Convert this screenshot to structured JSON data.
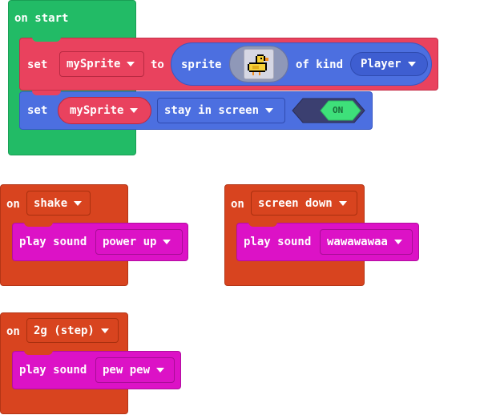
{
  "on_start": {
    "hat_label": "on start",
    "set1": {
      "keyword": "set",
      "variable": "mySprite",
      "to_label": "to",
      "sprite_label": "sprite",
      "of_kind_label": "of kind",
      "kind": "Player",
      "image": "duck-sprite"
    },
    "set2": {
      "keyword": "set",
      "variable": "mySprite",
      "property": "stay in screen",
      "toggle": "ON"
    }
  },
  "event_blocks": [
    {
      "on_label": "on",
      "event": "shake",
      "action_label": "play sound",
      "sound": "power up"
    },
    {
      "on_label": "on",
      "event": "screen down",
      "action_label": "play sound",
      "sound": "wawawawaa"
    },
    {
      "on_label": "on",
      "event": "2g (step)",
      "action_label": "play sound",
      "sound": "pew pew"
    }
  ],
  "colors": {
    "loops_green": "#22bb66",
    "sprites_red": "#e9425e",
    "sprites_blue": "#4c6fe0",
    "controller_orange": "#d8441f",
    "music_magenta": "#dc12c6",
    "toggle_green": "#3ee07a",
    "toggle_dark": "#3b3f70"
  }
}
